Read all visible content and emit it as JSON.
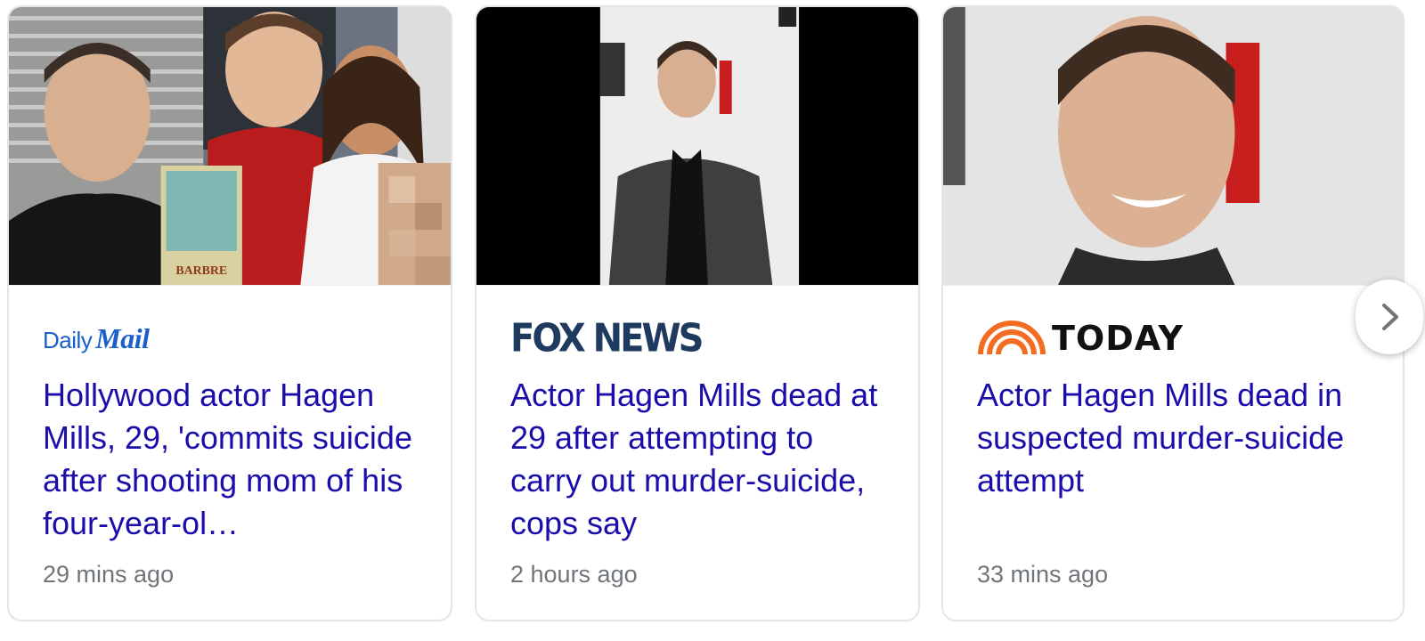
{
  "cards": [
    {
      "publisher": {
        "logo_text_1": "Daily",
        "logo_text_2": "Mail",
        "color": "#1b5fcc"
      },
      "headline": "Hollywood actor Hagen Mills, 29, 'commits suicide after shooting mom of his four-year-ol…",
      "time": "29 mins ago",
      "image": {
        "icon": "news-photo",
        "movie_poster_text": "BARBRE"
      }
    },
    {
      "publisher": {
        "logo_text": "FOX NEWS",
        "color": "#1e3a5f"
      },
      "headline": "Actor Hagen Mills dead at 29 after attempting to carry out murder-suicide, cops say",
      "time": "2 hours ago",
      "image": {
        "icon": "news-photo"
      }
    },
    {
      "publisher": {
        "logo_text": "TODAY",
        "logo_icon": "rainbow-icon",
        "icon_color": "#f26d21"
      },
      "headline": "Actor Hagen Mills dead in suspected murder-suicide attempt",
      "time": "33 mins ago",
      "image": {
        "icon": "news-photo"
      }
    }
  ],
  "navigation": {
    "next_icon": "chevron-right-icon"
  },
  "colors": {
    "headline": "#1a0dab",
    "timestamp": "#70757a",
    "border": "#e3e5e8"
  }
}
